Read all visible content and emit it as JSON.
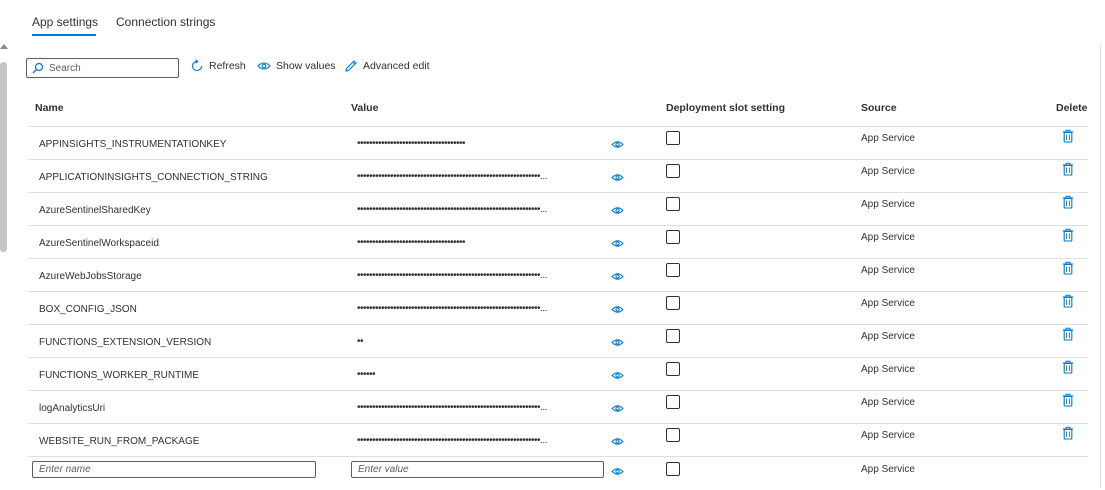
{
  "tabs": [
    {
      "label": "App settings",
      "active": true
    },
    {
      "label": "Connection strings",
      "active": false
    }
  ],
  "toolbar": {
    "search_placeholder": "Search",
    "refresh_label": "Refresh",
    "show_values_label": "Show values",
    "advanced_edit_label": "Advanced edit"
  },
  "columns": {
    "name": "Name",
    "value": "Value",
    "slot": "Deployment slot setting",
    "source": "Source",
    "delete": "Delete"
  },
  "rows": [
    {
      "name": "APPINSIGHTS_INSTRUMENTATIONKEY",
      "value": "••••••••••••••••••••••••••••••••••••",
      "source": "App Service",
      "slot_setting": false
    },
    {
      "name": "APPLICATIONINSIGHTS_CONNECTION_STRING",
      "value": "•••••••••••••••••••••••••••••••••••••••••••••••••••••••••••••...",
      "source": "App Service",
      "slot_setting": false
    },
    {
      "name": "AzureSentinelSharedKey",
      "value": "•••••••••••••••••••••••••••••••••••••••••••••••••••••••••••••...",
      "source": "App Service",
      "slot_setting": false
    },
    {
      "name": "AzureSentinelWorkspaceid",
      "value": "••••••••••••••••••••••••••••••••••••",
      "source": "App Service",
      "slot_setting": false
    },
    {
      "name": "AzureWebJobsStorage",
      "value": "•••••••••••••••••••••••••••••••••••••••••••••••••••••••••••••...",
      "source": "App Service",
      "slot_setting": false
    },
    {
      "name": "BOX_CONFIG_JSON",
      "value": "•••••••••••••••••••••••••••••••••••••••••••••••••••••••••••••...",
      "source": "App Service",
      "slot_setting": false
    },
    {
      "name": "FUNCTIONS_EXTENSION_VERSION",
      "value": "••",
      "source": "App Service",
      "slot_setting": false
    },
    {
      "name": "FUNCTIONS_WORKER_RUNTIME",
      "value": "••••••",
      "source": "App Service",
      "slot_setting": false
    },
    {
      "name": "logAnalyticsUri",
      "value": "•••••••••••••••••••••••••••••••••••••••••••••••••••••••••••••...",
      "source": "App Service",
      "slot_setting": false
    },
    {
      "name": "WEBSITE_RUN_FROM_PACKAGE",
      "value": "•••••••••••••••••••••••••••••••••••••••••••••••••••••••••••••...",
      "source": "App Service",
      "slot_setting": false
    }
  ],
  "new_row": {
    "name_placeholder": "Enter name",
    "value_placeholder": "Enter value",
    "source": "App Service"
  },
  "colors": {
    "accent": "#0078d4",
    "text": "#323130",
    "border": "#e1dfdd"
  }
}
